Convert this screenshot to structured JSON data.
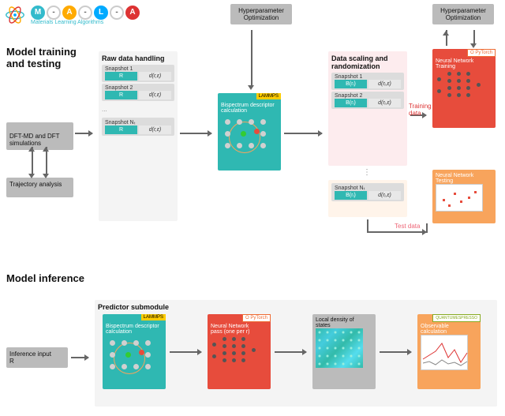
{
  "logo": {
    "tagline": "Materials Learning Algorithms",
    "letters": [
      "M",
      "A",
      "L",
      "A"
    ]
  },
  "section1_title": "Model training\nand testing",
  "section2_title": "Model inference",
  "hyperopt": "Hyperparameter\nOptimization",
  "training": {
    "dftmd": "DFT-MD and DFT\nsimulations",
    "traj": "Trajectory analysis",
    "rawdata": {
      "title": "Raw data handling",
      "snap1": "Snapshot 1",
      "snap2": "Snapshot 2",
      "snapN": "Snapshot Nₜ",
      "R": "R",
      "d": "d(r,ε)"
    },
    "bispectrum": "Bispectrum descriptor\ncalculation",
    "scaling": {
      "title": "Data scaling and\nrandomization",
      "snap1": "Snapshot 1",
      "snap2": "Snapshot 2",
      "snapN": "Snapshot Nₜ",
      "B": "B(rᵢ)",
      "d": "d(rᵢ,ε)"
    },
    "nn_train": "Neural Network\nTraining",
    "nn_test": "Neural Network\nTesting",
    "train_data": "Training\ndata",
    "test_data": "Test data"
  },
  "inference": {
    "input": "Inference input\nR",
    "predictor": "Predictor submodule",
    "bispectrum": "Bispectrum descriptor\ncalculation",
    "nn_pass": "Neural Network\npass (one per r)",
    "ldos": "Local density of\nstates",
    "obs": "Observable\ncalculation"
  },
  "tags": {
    "lammps": "LAMMPS",
    "pytorch": "O PyTorch",
    "qe": "QUANTUMESPRESSO"
  }
}
